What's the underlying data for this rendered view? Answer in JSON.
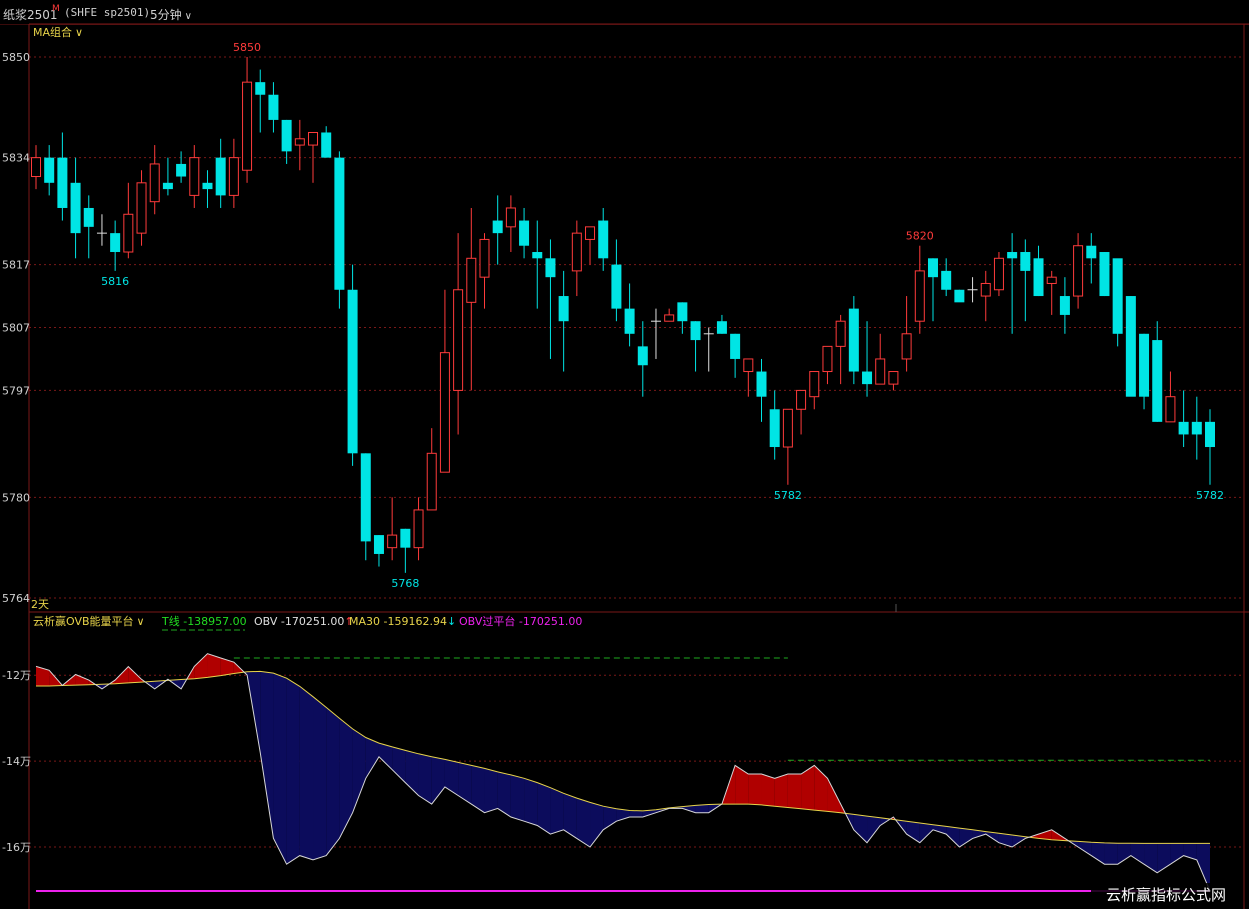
{
  "header": {
    "contract": "纸浆2501",
    "mark": "M",
    "exchange": "(SHFE sp2501)",
    "period": "5分钟",
    "period_arrow": "∨"
  },
  "main_panel": {
    "indicator_menu": "MA组合",
    "span_label": "2天",
    "y_ticks": [
      "5850",
      "5834",
      "5817",
      "5807",
      "5797",
      "5780",
      "5764"
    ]
  },
  "sub_panel": {
    "indicator_name": "云析赢OVB能量平台",
    "legend": [
      {
        "label": "T线",
        "value": "-138957.00",
        "color": "#22dd22"
      },
      {
        "label": "OBV",
        "value": "-170251.00",
        "color": "#e0e0e0",
        "arrow": "↑"
      },
      {
        "label": "MA30",
        "value": "-159162.94",
        "color": "#e8d44a",
        "arrow": "↓"
      },
      {
        "label": "OBV过平台",
        "value": "-170251.00",
        "color": "#ee22ee"
      }
    ],
    "y_ticks": [
      "-12万",
      "-14万",
      "-16万"
    ]
  },
  "watermark": "云析赢指标公式网",
  "colors": {
    "up": "#ff3b3b",
    "down": "#00e5e5",
    "neutral": "#e0e0e0",
    "grid": "#7a1818",
    "obv_above": "#b00000",
    "obv_below": "#0c0c5c",
    "ma_line": "#e8d44a",
    "platform": "#1faa1f",
    "baseline": "#ee22ee"
  },
  "chart_data": [
    {
      "type": "candlestick",
      "x": [
        1,
        2,
        3,
        4,
        5,
        6,
        7,
        8,
        9,
        10,
        11,
        12,
        13,
        14,
        15,
        16,
        17,
        18,
        19,
        20,
        21,
        22,
        23,
        24,
        25,
        26,
        27,
        28,
        29,
        30,
        31,
        32,
        33,
        34,
        35,
        36,
        37,
        38,
        39,
        40,
        41,
        42,
        43,
        44,
        45,
        46,
        47,
        48,
        49,
        50,
        51,
        52,
        53,
        54,
        55,
        56,
        57,
        58,
        59,
        60,
        61,
        62,
        63,
        64,
        65,
        66,
        67,
        68,
        69,
        70,
        71,
        72,
        73,
        74,
        75,
        76,
        77,
        78,
        79,
        80,
        81,
        82,
        83,
        84,
        85,
        86,
        87,
        88,
        89,
        90
      ],
      "open": [
        5831,
        5834,
        5834,
        5830,
        5826,
        5822,
        5822,
        5819,
        5822,
        5827,
        5830,
        5833,
        5828,
        5830,
        5834,
        5828,
        5832,
        5846,
        5844,
        5840,
        5836,
        5836,
        5838,
        5834,
        5813,
        5787,
        5774,
        5772,
        5775,
        5772,
        5778,
        5784,
        5797,
        5811,
        5815,
        5824,
        5823,
        5824,
        5819,
        5818,
        5812,
        5816,
        5821,
        5824,
        5817,
        5810,
        5804,
        5808,
        5808,
        5811,
        5808,
        5806,
        5808,
        5806,
        5800,
        5800,
        5794,
        5788,
        5794,
        5796,
        5800,
        5804,
        5810,
        5800,
        5798,
        5798,
        5802,
        5808,
        5818,
        5816,
        5813,
        5813,
        5812,
        5813,
        5819,
        5819,
        5818,
        5814,
        5812,
        5812,
        5820,
        5819,
        5818,
        5812,
        5806,
        5805,
        5792,
        5792,
        5792,
        5792
      ],
      "close": [
        5834,
        5830,
        5826,
        5822,
        5823,
        5822,
        5819,
        5825,
        5830,
        5833,
        5829,
        5831,
        5834,
        5829,
        5828,
        5834,
        5846,
        5844,
        5840,
        5835,
        5837,
        5838,
        5834,
        5813,
        5787,
        5773,
        5771,
        5774,
        5772,
        5778,
        5787,
        5803,
        5813,
        5818,
        5821,
        5822,
        5826,
        5820,
        5818,
        5815,
        5808,
        5822,
        5823,
        5818,
        5810,
        5806,
        5801,
        5808,
        5809,
        5808,
        5805,
        5806,
        5806,
        5802,
        5802,
        5796,
        5788,
        5794,
        5797,
        5800,
        5804,
        5808,
        5800,
        5798,
        5802,
        5800,
        5806,
        5816,
        5815,
        5813,
        5811,
        5813,
        5814,
        5818,
        5818,
        5816,
        5812,
        5815,
        5809,
        5820,
        5818,
        5812,
        5806,
        5796,
        5796,
        5792,
        5796,
        5790,
        5790,
        5788
      ],
      "high": [
        5836,
        5836,
        5838,
        5834,
        5828,
        5825,
        5824,
        5830,
        5832,
        5836,
        5834,
        5835,
        5836,
        5832,
        5837,
        5837,
        5850,
        5848,
        5846,
        5840,
        5840,
        5838,
        5839,
        5835,
        5817,
        5787,
        5774,
        5780,
        5775,
        5780,
        5791,
        5813,
        5822,
        5826,
        5822,
        5828,
        5828,
        5826,
        5824,
        5821,
        5816,
        5824,
        5823,
        5826,
        5821,
        5814,
        5808,
        5810,
        5810,
        5811,
        5808,
        5807,
        5809,
        5806,
        5800,
        5802,
        5797,
        5790,
        5796,
        5798,
        5802,
        5809,
        5812,
        5808,
        5806,
        5800,
        5812,
        5820,
        5818,
        5818,
        5813,
        5815,
        5816,
        5819,
        5822,
        5821,
        5820,
        5816,
        5815,
        5822,
        5822,
        5819,
        5814,
        5812,
        5806,
        5808,
        5800,
        5797,
        5796,
        5794
      ],
      "low": [
        5829,
        5828,
        5824,
        5818,
        5818,
        5820,
        5816,
        5818,
        5820,
        5825,
        5828,
        5830,
        5826,
        5826,
        5826,
        5826,
        5830,
        5838,
        5838,
        5833,
        5832,
        5830,
        5834,
        5810,
        5785,
        5770,
        5769,
        5770,
        5768,
        5770,
        5778,
        5784,
        5790,
        5797,
        5810,
        5817,
        5819,
        5818,
        5810,
        5802,
        5800,
        5812,
        5817,
        5816,
        5808,
        5804,
        5796,
        5802,
        5808,
        5806,
        5800,
        5800,
        5806,
        5799,
        5796,
        5792,
        5786,
        5782,
        5790,
        5794,
        5798,
        5798,
        5798,
        5796,
        5798,
        5797,
        5800,
        5806,
        5808,
        5812,
        5812,
        5811,
        5808,
        5812,
        5806,
        5808,
        5812,
        5809,
        5806,
        5810,
        5814,
        5812,
        5804,
        5798,
        5794,
        5792,
        5796,
        5788,
        5786,
        5782
      ]
    },
    {
      "type": "area",
      "title": "云析赢OVB能量平台",
      "x": [
        1,
        2,
        3,
        4,
        5,
        6,
        7,
        8,
        9,
        10,
        11,
        12,
        13,
        14,
        15,
        16,
        17,
        18,
        19,
        20,
        21,
        22,
        23,
        24,
        25,
        26,
        27,
        28,
        29,
        30,
        31,
        32,
        33,
        34,
        35,
        36,
        37,
        38,
        39,
        40,
        41,
        42,
        43,
        44,
        45,
        46,
        47,
        48,
        49,
        50,
        51,
        52,
        53,
        54,
        55,
        56,
        57,
        58,
        59,
        60,
        61,
        62,
        63,
        64,
        65,
        66,
        67,
        68,
        69,
        70,
        71,
        72,
        73,
        74,
        75,
        76,
        77,
        78,
        79,
        80,
        81,
        82,
        83,
        84,
        85,
        86,
        87,
        88,
        89,
        90
      ],
      "series": [
        {
          "name": "OBV",
          "values": [
            -117958,
            -118858,
            -122361,
            -119826,
            -121128,
            -123186,
            -121128,
            -118000,
            -120958,
            -123186,
            -120958,
            -123186,
            -117958,
            -115000,
            -116000,
            -116958,
            -119958,
            -137958,
            -157958,
            -164000,
            -162000,
            -163000,
            -162000,
            -158000,
            -152000,
            -144000,
            -139000,
            -142000,
            -145000,
            -148000,
            -150000,
            -146000,
            -148000,
            -150000,
            -152000,
            -151000,
            -153000,
            -154000,
            -155000,
            -157000,
            -156000,
            -158000,
            -160000,
            -156000,
            -154000,
            -153000,
            -153000,
            -152000,
            -151000,
            -151000,
            -152000,
            -152000,
            -150000,
            -141000,
            -143000,
            -143000,
            -144000,
            -143000,
            -143000,
            -141000,
            -144000,
            -150000,
            -156000,
            -159000,
            -155000,
            -153000,
            -157000,
            -159000,
            -156000,
            -157000,
            -160000,
            -158000,
            -157000,
            -159000,
            -160000,
            -158000,
            -157000,
            -156000,
            -158000,
            -160000,
            -162000,
            -164000,
            -164000,
            -162000,
            -164000,
            -166000,
            -164000,
            -162000,
            -163000,
            -170251
          ]
        },
        {
          "name": "MA30",
          "values": [
            -122500,
            -122500,
            -122400,
            -122300,
            -122200,
            -122100,
            -122000,
            -121800,
            -121600,
            -121400,
            -121200,
            -121000,
            -120800,
            -120500,
            -120100,
            -119600,
            -119200,
            -119100,
            -119500,
            -120700,
            -122600,
            -125000,
            -127500,
            -130000,
            -132500,
            -134500,
            -135800,
            -136700,
            -137500,
            -138300,
            -139000,
            -139600,
            -140300,
            -141000,
            -141700,
            -142500,
            -143200,
            -144000,
            -145000,
            -146200,
            -147500,
            -148600,
            -149600,
            -150500,
            -151100,
            -151500,
            -151600,
            -151300,
            -150900,
            -150600,
            -150300,
            -150100,
            -150000,
            -150000,
            -150000,
            -150200,
            -150500,
            -150800,
            -151100,
            -151400,
            -151700,
            -152000,
            -152400,
            -152800,
            -153200,
            -153600,
            -154000,
            -154400,
            -154800,
            -155200,
            -155600,
            -156000,
            -156400,
            -156800,
            -157200,
            -157600,
            -158000,
            -158300,
            -158500,
            -158700,
            -158900,
            -159050,
            -159100,
            -159130,
            -159150,
            -159155,
            -159160,
            -159161,
            -159162,
            -159162.94
          ]
        }
      ],
      "platforms": [
        {
          "x_start": 16,
          "x_end": 58,
          "value": -116000
        },
        {
          "x_start": 58,
          "x_end": 90,
          "value": -139800
        }
      ],
      "baseline": -170251,
      "ylim": [
        -173500,
        -111800
      ]
    }
  ]
}
